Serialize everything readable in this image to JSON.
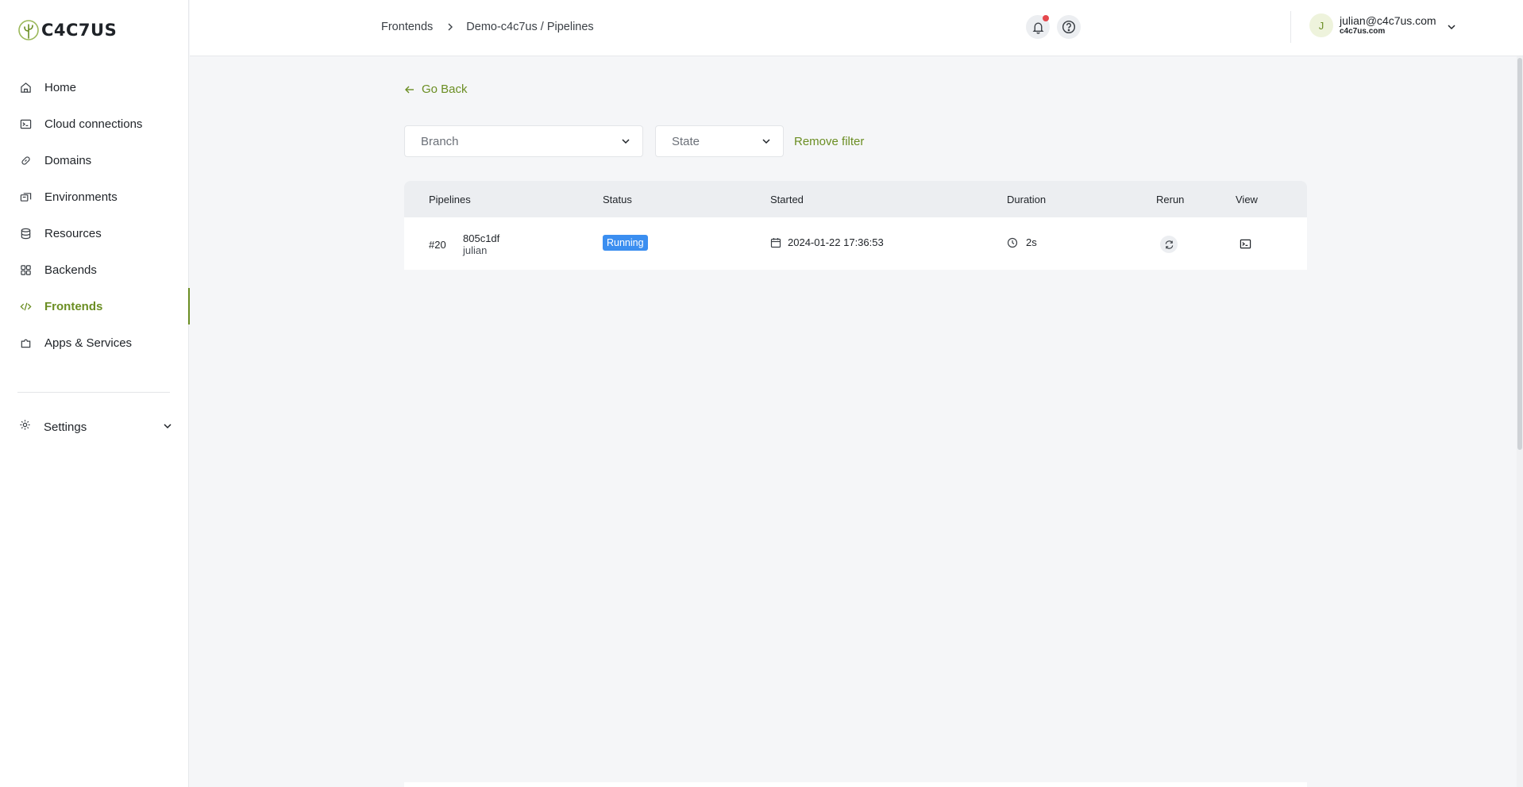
{
  "brand": {
    "name": "C4C7US",
    "accent": "#6b8e23"
  },
  "sidebar": {
    "items": [
      {
        "label": "Home",
        "icon": "home-icon"
      },
      {
        "label": "Cloud connections",
        "icon": "terminal-icon"
      },
      {
        "label": "Domains",
        "icon": "link-icon"
      },
      {
        "label": "Environments",
        "icon": "environments-icon"
      },
      {
        "label": "Resources",
        "icon": "database-icon"
      },
      {
        "label": "Backends",
        "icon": "grid-icon"
      },
      {
        "label": "Frontends",
        "icon": "code-icon",
        "active": true
      },
      {
        "label": "Apps & Services",
        "icon": "puzzle-icon"
      }
    ],
    "settings_label": "Settings"
  },
  "header": {
    "breadcrumb": [
      "Frontends",
      "Demo-c4c7us / Pipelines"
    ],
    "user": {
      "initial": "J",
      "email": "julian@c4c7us.com",
      "org": "c4c7us.com"
    }
  },
  "main": {
    "go_back": "Go Back",
    "filters": {
      "branch_placeholder": "Branch",
      "state_placeholder": "State",
      "remove_label": "Remove filter"
    },
    "table": {
      "columns": [
        "Pipelines",
        "Status",
        "Started",
        "Duration",
        "Rerun",
        "View"
      ],
      "rows": [
        {
          "number": "#20",
          "commit": "805c1df",
          "author": "julian",
          "status": "Running",
          "started": "2024-01-22 17:36:53",
          "duration": "2s"
        }
      ]
    }
  }
}
